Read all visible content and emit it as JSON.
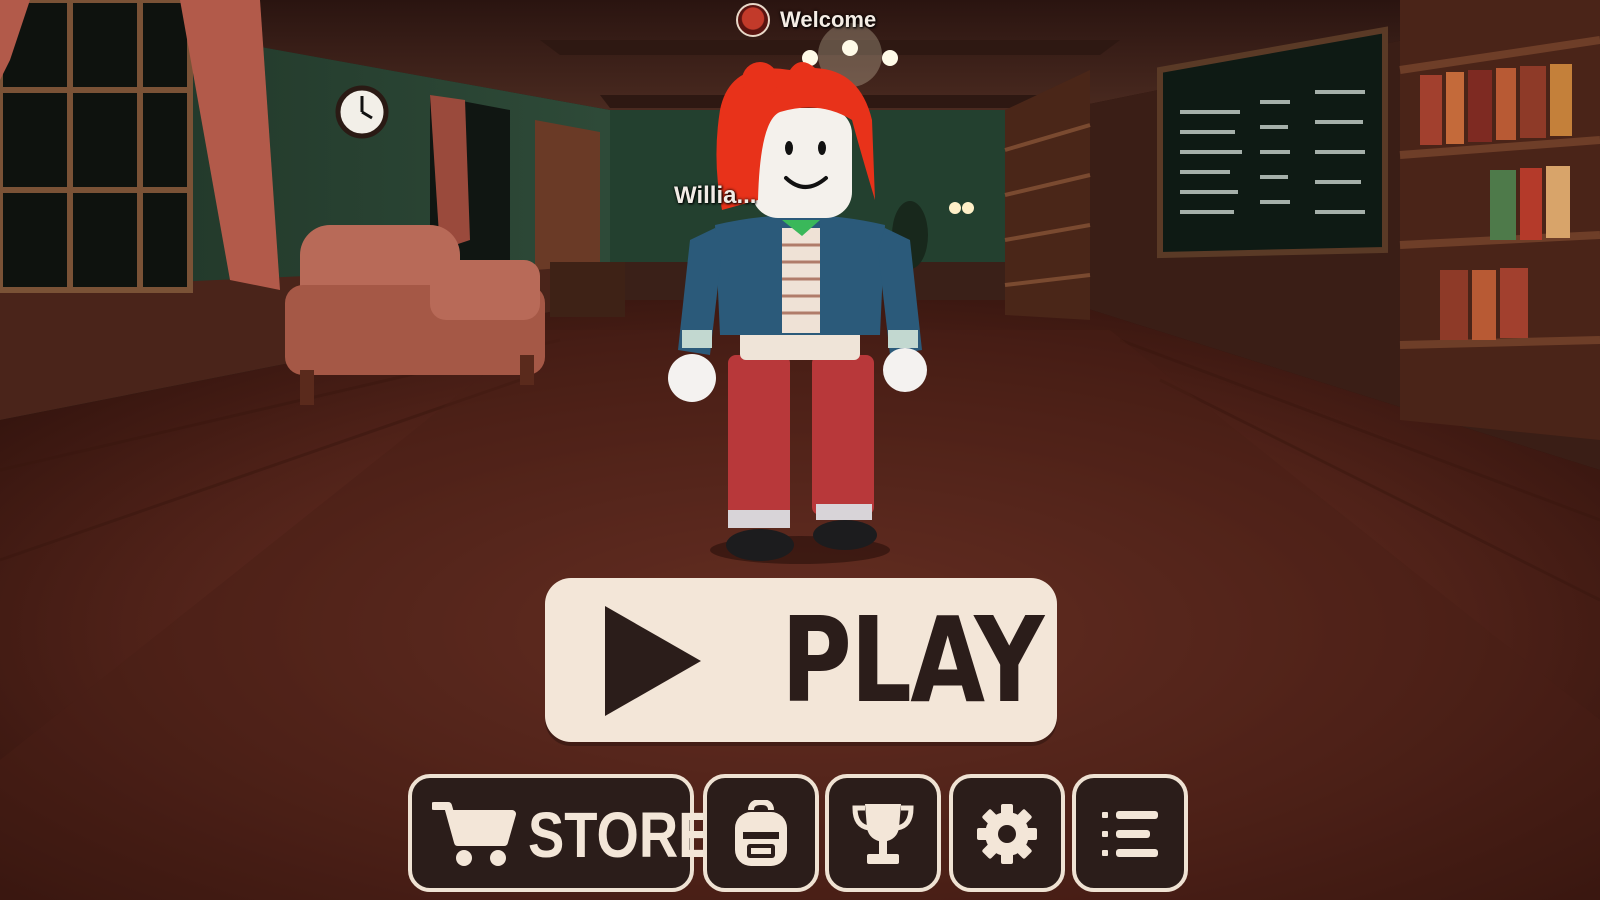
{
  "hud": {
    "welcome_label": "Welcome",
    "player_name_tag": "Willia..."
  },
  "main": {
    "play_label": "PLAY"
  },
  "toolbar": {
    "store_label": "STORE",
    "items": [
      {
        "icon": "shopping-cart-icon"
      },
      {
        "icon": "backpack-icon"
      },
      {
        "icon": "trophy-icon"
      },
      {
        "icon": "gear-icon"
      },
      {
        "icon": "list-menu-icon"
      }
    ]
  },
  "colors": {
    "button_light": "#f3e6d8",
    "button_dark": "#2b1d1a",
    "floor": "#5a2a20"
  }
}
